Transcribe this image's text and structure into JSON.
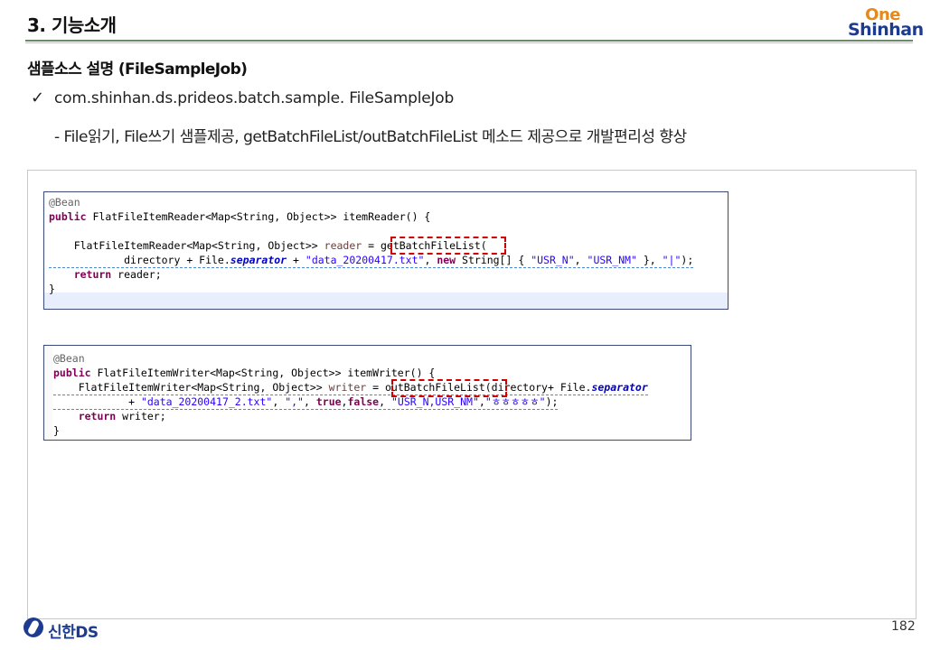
{
  "header": {
    "title": "3. 기능소개",
    "logo_top": "One",
    "logo_bottom": "Shinhan"
  },
  "section_title": "샘플소스 설명 (FileSampleJob)",
  "bullet": {
    "mark": "✓",
    "text": "com.shinhan.ds.prideos.batch.sample. FileSampleJob",
    "sub": "- File읽기, File쓰기 샘플제공, getBatchFileList/outBatchFileList 메소드 제공으로 개발편리성 향상"
  },
  "code_reader": {
    "annotation": "@Bean",
    "kw_public": "public",
    "sig_rest": " FlatFileItemReader<Map<String, Object>> itemReader() {",
    "decl_type": "    FlatFileItemReader<Map<String, Object>> ",
    "decl_var": "reader",
    "decl_assign": " = ",
    "method": "getBatchFileList(",
    "args_pre": "            directory + File.",
    "args_field": "separator",
    "args_plus": " + ",
    "args_str": "\"data_20200417.txt\"",
    "args_comma": ", ",
    "args_new": "new",
    "args_arr": " String[] { ",
    "args_s1": "\"USR_N\"",
    "args_c2": ", ",
    "args_s2": "\"USR_NM\"",
    "args_end1": " }, ",
    "args_s3": "\"|\"",
    "args_end2": ");",
    "ret_kw": "    return",
    "ret_var": " reader;",
    "close": "}"
  },
  "code_writer": {
    "annotation": "@Bean",
    "kw_public": "public",
    "sig_rest": " FlatFileItemWriter<Map<String, Object>> itemWriter() {",
    "decl_type": "    FlatFileItemWriter<Map<String, Object>> ",
    "decl_var": "writer",
    "decl_assign": " = ",
    "method": "outBatchFileList(",
    "args_dir": "directory+ File.",
    "args_field": "separator",
    "l2_pre": "            + ",
    "l2_s1": "\"data_20200417_2.txt\"",
    "l2_c1": ", ",
    "l2_s2": "\",\"",
    "l2_c2": ", ",
    "l2_true": "true",
    "l2_c3": ",",
    "l2_false": "false",
    "l2_c4": ", ",
    "l2_s3": "\"USR_N,USR_NM\"",
    "l2_c5": ",",
    "l2_s4": "\"ㅎㅎㅎㅎㅎ\"",
    "l2_end": ");",
    "ret_kw": "    return",
    "ret_var": " writer;",
    "close": "}"
  },
  "footer": {
    "company": "신한DS",
    "page": "182"
  }
}
